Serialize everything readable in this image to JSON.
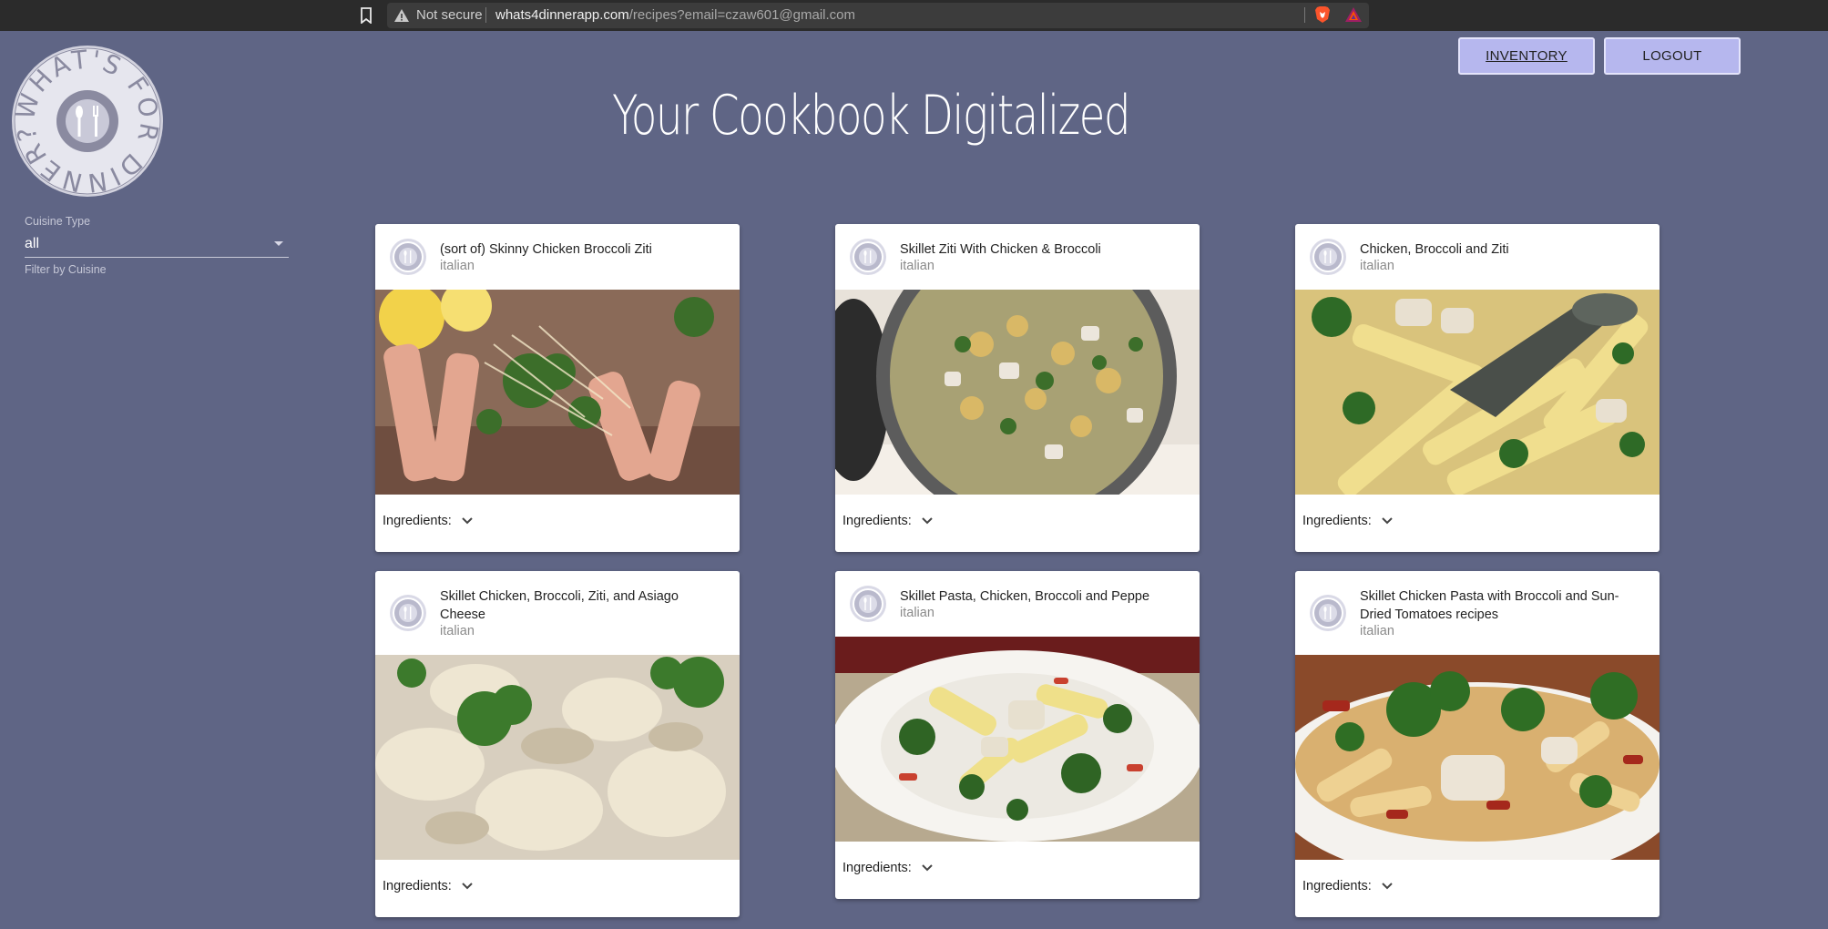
{
  "browser": {
    "not_secure": "Not secure",
    "url_host": "whats4dinnerapp.com",
    "url_path": "/recipes?email=czaw601@gmail.com"
  },
  "header": {
    "inventory_label": "INVENTORY",
    "logout_label": "LOGOUT",
    "title": "Your Cookbook Digitalized",
    "logo_text": "WHAT'S FOR DINNER?"
  },
  "filter": {
    "label": "Cuisine Type",
    "value": "all",
    "helper": "Filter by Cuisine"
  },
  "recipes": [
    {
      "title": "(sort of) Skinny Chicken Broccoli Ziti",
      "cuisine": "italian",
      "ingredients_label": "Ingredients:"
    },
    {
      "title": "Skillet Ziti With Chicken & Broccoli",
      "cuisine": "italian",
      "ingredients_label": "Ingredients:"
    },
    {
      "title": "Chicken, Broccoli and Ziti",
      "cuisine": "italian",
      "ingredients_label": "Ingredients:"
    },
    {
      "title": "Skillet Chicken, Broccoli, Ziti, and Asiago Cheese",
      "cuisine": "italian",
      "ingredients_label": "Ingredients:"
    },
    {
      "title": "Skillet Pasta, Chicken, Broccoli and Peppe",
      "cuisine": "italian",
      "ingredients_label": "Ingredients:"
    },
    {
      "title": "Skillet Chicken Pasta with Broccoli and Sun-Dried Tomatoes recipes",
      "cuisine": "italian",
      "ingredients_label": "Ingredients:"
    }
  ],
  "colors": {
    "background": "#5f6585",
    "button": "#b6b7ee",
    "card": "#ffffff",
    "broccoli": "#3c6e2a",
    "pasta": "#e9d9a8"
  }
}
